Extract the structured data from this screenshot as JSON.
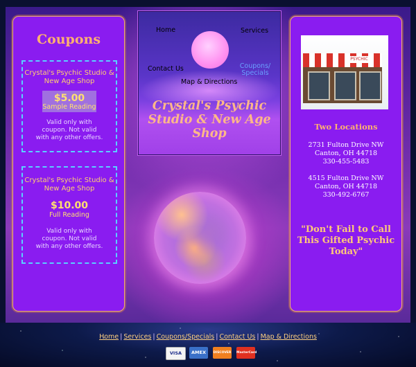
{
  "nav": {
    "home": "Home",
    "services": "Services",
    "contact": "Contact Us",
    "coupons": "Coupons/ Specials",
    "map": "Map & Directions"
  },
  "header": {
    "title": "Crystal's Psychic Studio & New Age Shop"
  },
  "coupons": {
    "title": "Coupons",
    "items": [
      {
        "shop": "Crystal's Psychic Studio & New Age Shop",
        "price": "$5.00",
        "label": "Sample Reading",
        "terms": "Valid only with coupon. Not valid with any other offers."
      },
      {
        "shop": "Crystal's Psychic Studio & New Age Shop",
        "price": "$10.00",
        "label": "Full Reading",
        "terms": "Valid only with coupon. Not valid with any other offers."
      }
    ]
  },
  "right": {
    "store_sign": "PSYCHIC",
    "locations_title": "Two Locations",
    "locations": [
      {
        "street": "2731 Fulton Drive NW",
        "city": "Canton, OH 44718",
        "phone": "330-455-5483"
      },
      {
        "street": "4515 Fulton Drive NW",
        "city": "Canton, OH 44718",
        "phone": "330-492-6767"
      }
    ],
    "tagline": "\"Don't Fail to Call This Gifted Psychic Today\""
  },
  "footer": {
    "links": [
      "Home",
      "Services",
      "Coupons/Specials",
      "Contact Us",
      "Map & Directions"
    ],
    "separator": "|",
    "cards": [
      "VISA",
      "AMEX",
      "DISCOVER",
      "MasterCard"
    ]
  },
  "colors": {
    "panel": "#8a1cf0",
    "accent_orange": "#ffb070",
    "dashed_border": "#5ad0ff"
  }
}
